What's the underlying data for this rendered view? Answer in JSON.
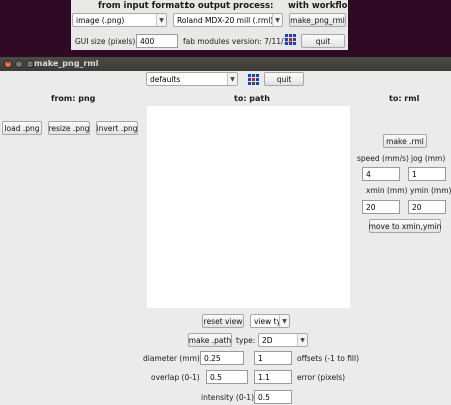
{
  "launcher": {
    "headers": {
      "input_format": "from input format:",
      "output_process": "to output process:",
      "workflow": "with workflow:"
    },
    "input_format_value": "image (.png)",
    "output_process_value": "Roland MDX-20 mill (.rml)",
    "workflow_button": "make_png_rml",
    "gui_size_label": "GUI size (pixels):",
    "gui_size_value": "400",
    "version_text": "fab modules version: 7/11/14",
    "quit_label": "quit"
  },
  "window": {
    "title": "make_png_rml",
    "defaults_value": "defaults",
    "quit_label": "quit",
    "columns": {
      "from": "from: png",
      "to_path": "to: path",
      "to_rml": "to: rml"
    },
    "png_buttons": {
      "load": "load .png",
      "resize": "resize .png",
      "invert": "invert .png"
    },
    "rml": {
      "make_label": "make .rml",
      "speed_label": "speed (mm/s)",
      "speed_value": "4",
      "jog_label": "jog (mm)",
      "jog_value": "1",
      "xmin_label": "xmin (mm)",
      "xmin_value": "20",
      "ymin_label": "ymin (mm)",
      "ymin_value": "20",
      "move_label": "move to xmin,ymin"
    },
    "path": {
      "reset_view": "reset view",
      "view_type": "view type",
      "make_path": "make .path",
      "type_label": "type:",
      "type_value": "2D",
      "diameter_label": "diameter (mm)",
      "diameter_value": "0.25",
      "offsets_value": "1",
      "offsets_label": "offsets (-1 to fill)",
      "overlap_label": "overlap (0-1)",
      "overlap_value": "0.5",
      "error_value": "1.1",
      "error_label": "error (pixels)",
      "intensity_label": "intensity (0-1)",
      "intensity_value": "0.5"
    }
  },
  "colors": {
    "desktop": "#300a24",
    "titlebar": "#3c3b37",
    "window_bg": "#ebebeb",
    "close_button": "#f07746"
  },
  "icons": [
    "fab-logo-icon",
    "combo-arrow-icon",
    "window-close-icon",
    "window-minimize-icon",
    "window-maximize-icon"
  ]
}
